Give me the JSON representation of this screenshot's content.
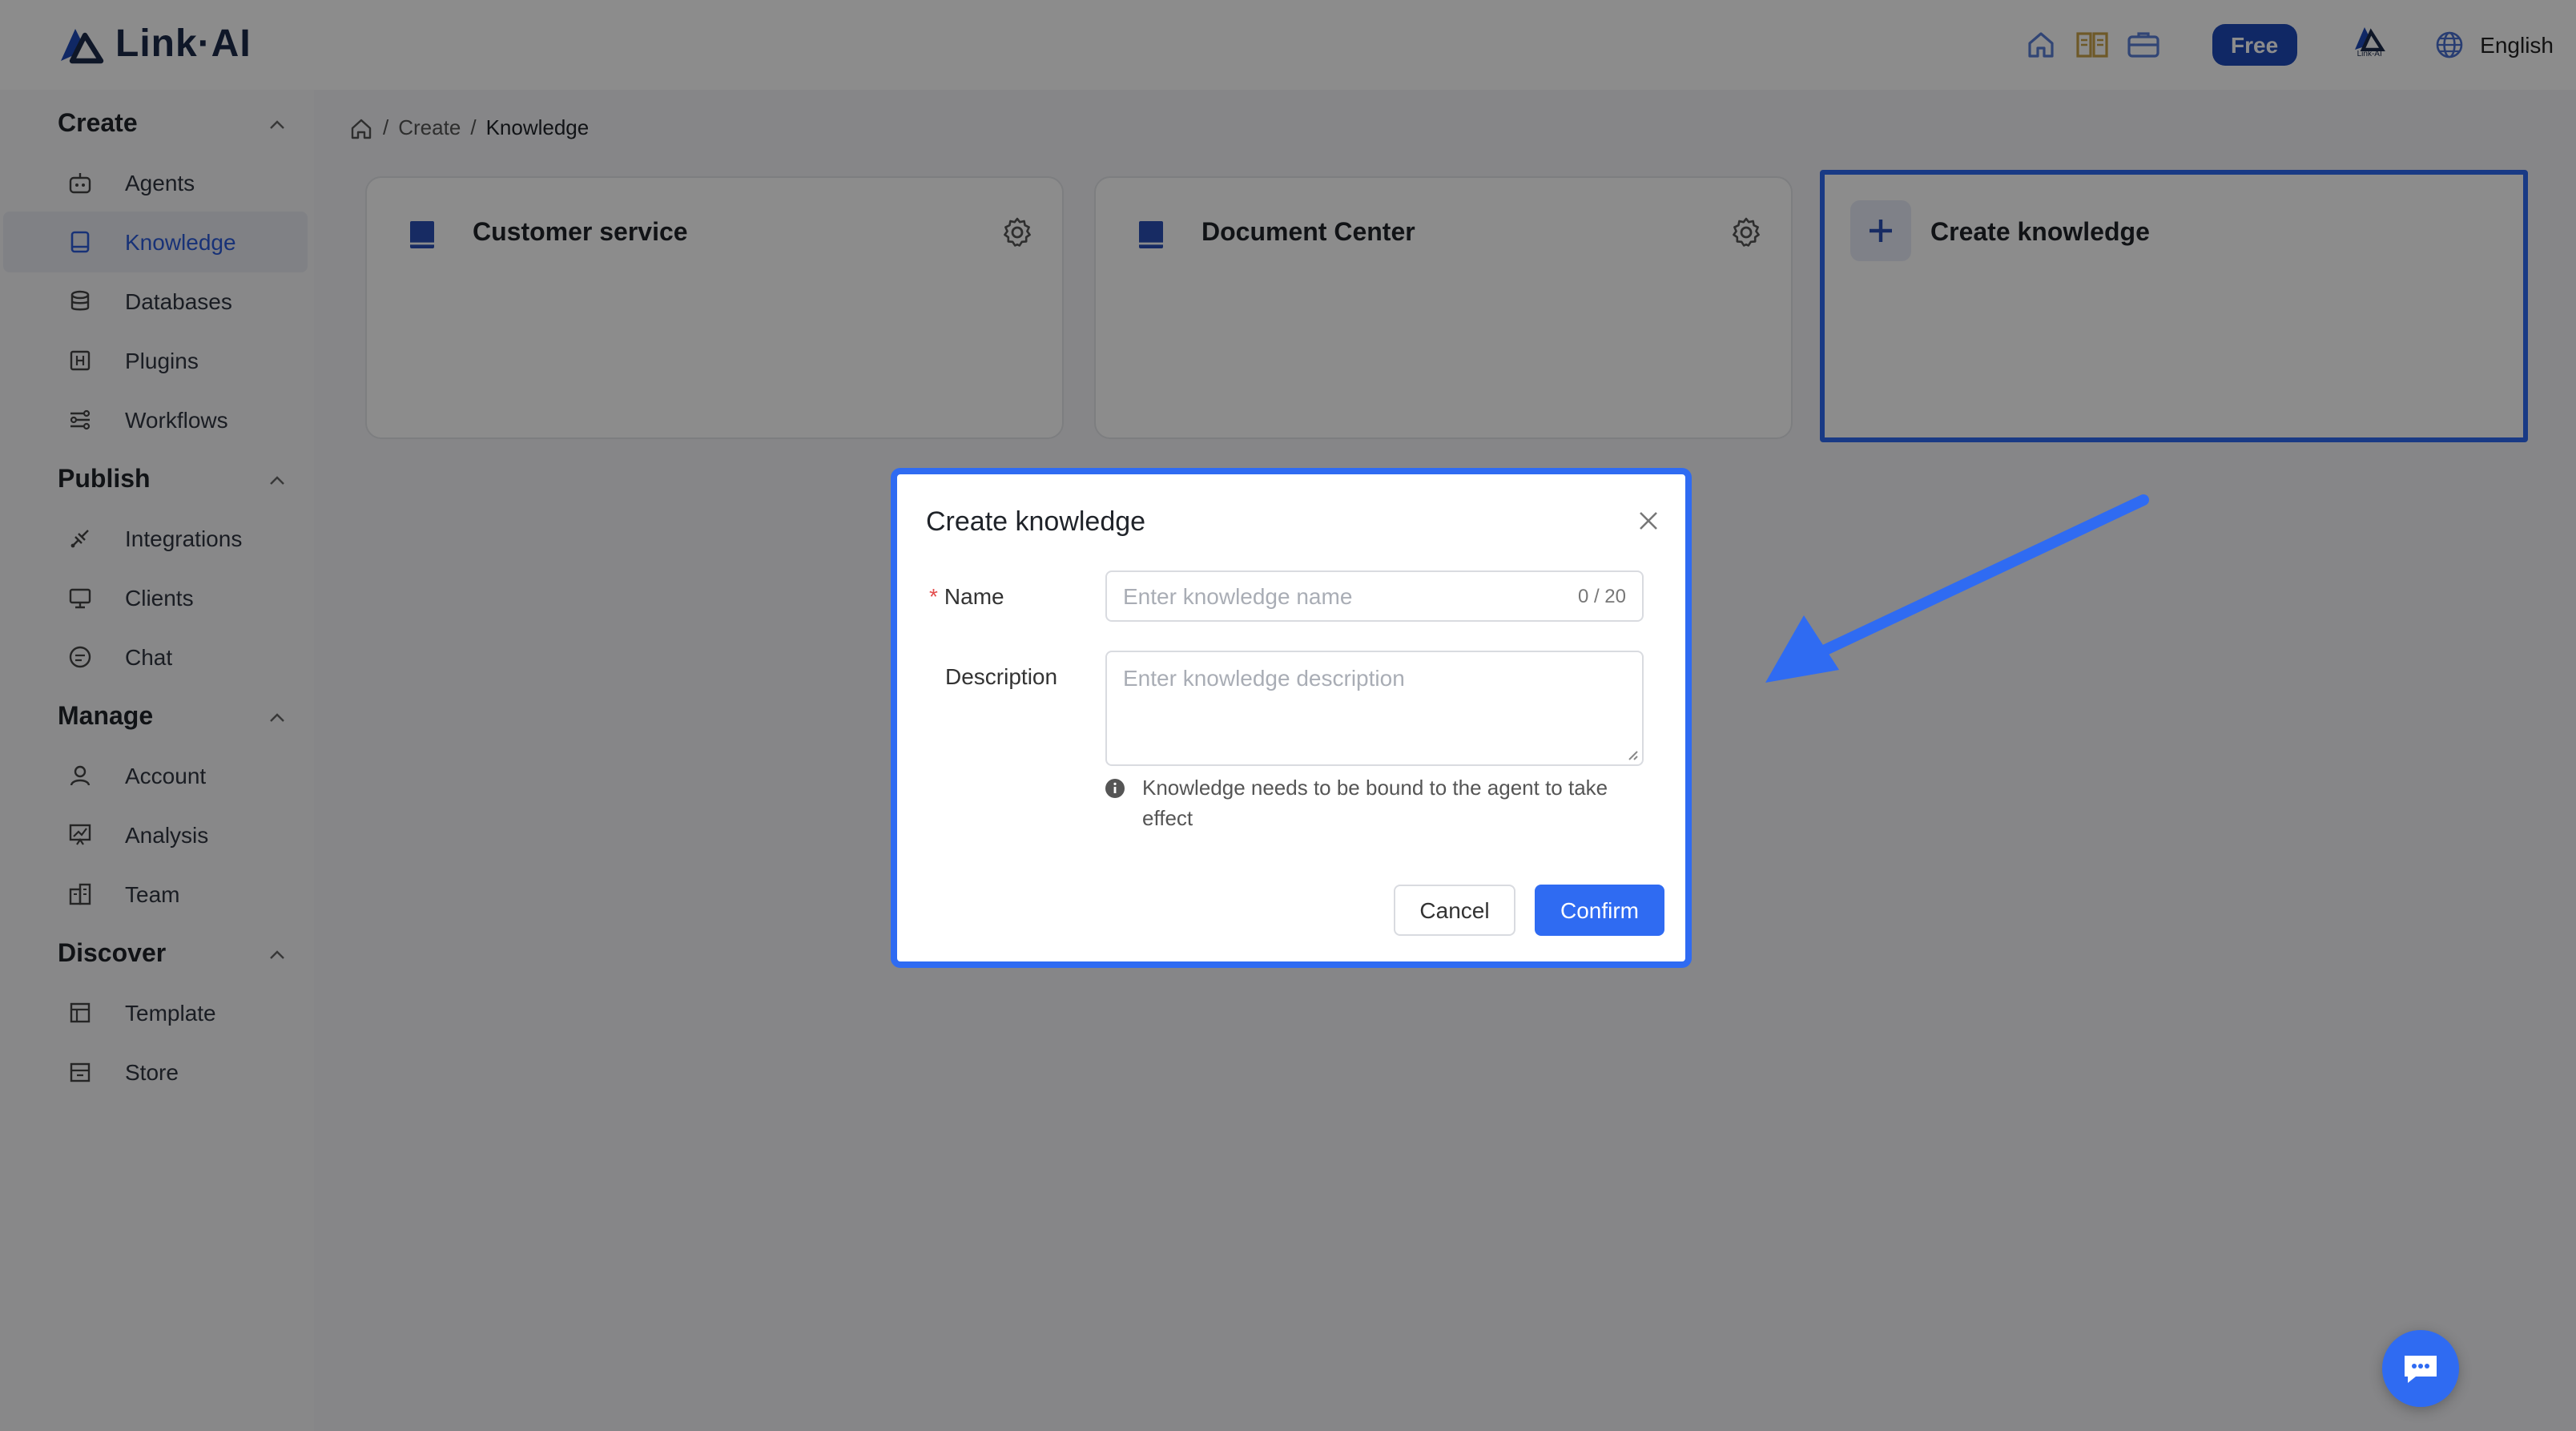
{
  "header": {
    "logo_text": "Link·AI",
    "plan_badge": "Free",
    "brand_mini": "Link-AI",
    "language": "English"
  },
  "sidebar": {
    "sections": [
      {
        "title": "Create",
        "items": [
          "Agents",
          "Knowledge",
          "Databases",
          "Plugins",
          "Workflows"
        ]
      },
      {
        "title": "Publish",
        "items": [
          "Integrations",
          "Clients",
          "Chat"
        ]
      },
      {
        "title": "Manage",
        "items": [
          "Account",
          "Analysis",
          "Team"
        ]
      },
      {
        "title": "Discover",
        "items": [
          "Template",
          "Store"
        ]
      }
    ],
    "active_item": "Knowledge"
  },
  "breadcrumb": {
    "items": [
      "Create",
      "Knowledge"
    ]
  },
  "cards": [
    {
      "title": "Customer service"
    },
    {
      "title": "Document Center"
    },
    {
      "title": "Create knowledge"
    }
  ],
  "modal": {
    "title": "Create knowledge",
    "name_label": "Name",
    "name_placeholder": "Enter knowledge name",
    "name_counter": "0 / 20",
    "description_label": "Description",
    "description_placeholder": "Enter knowledge description",
    "hint": "Knowledge needs to be bound to the agent to take effect",
    "cancel_label": "Cancel",
    "confirm_label": "Confirm"
  },
  "colors": {
    "accent": "#2f6bf2",
    "brand_dark": "#1e49b8",
    "active_text": "#2c5bd9"
  }
}
